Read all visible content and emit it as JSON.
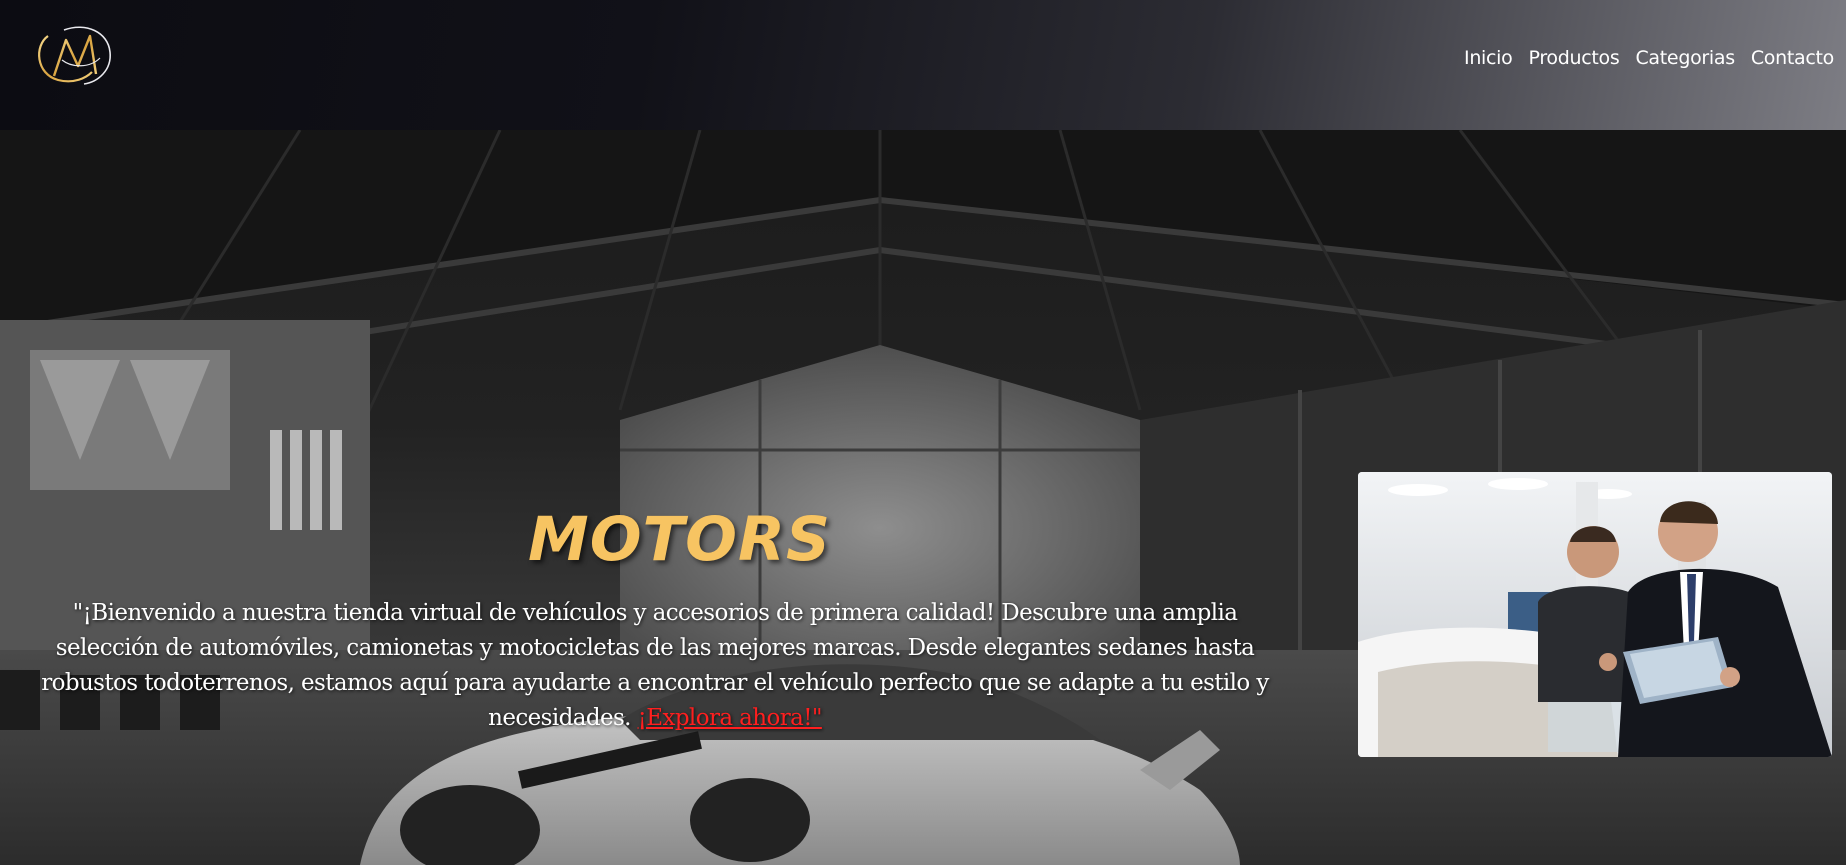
{
  "header": {
    "logo_icon": "gold-m-circle-logo",
    "brand_gold": "#e8b04a",
    "nav": [
      {
        "label": "Inicio"
      },
      {
        "label": "Productos"
      },
      {
        "label": "Categorias"
      },
      {
        "label": "Contacto"
      }
    ]
  },
  "hero": {
    "title": "MOTORS",
    "title_color": "#f7c462",
    "welcome_text": "\"¡Bienvenido a nuestra tienda virtual de vehículos y accesorios de primera calidad! Descubre una amplia selección de automóviles, camionetas y motocicletas de las mejores marcas. Desde elegantes sedanes hasta robustos todoterrenos, estamos aquí para ayudarte a encontrar el vehículo perfecto que se adapte a tu estilo y necesidades. ",
    "cta_link": "¡Explora ahora!\"",
    "cta_color": "#ff1f1f",
    "background_image": "warehouse-with-white-porsche-grayscale",
    "side_image": "salesman-showing-clipboard-to-customer-at-car-dealership"
  }
}
